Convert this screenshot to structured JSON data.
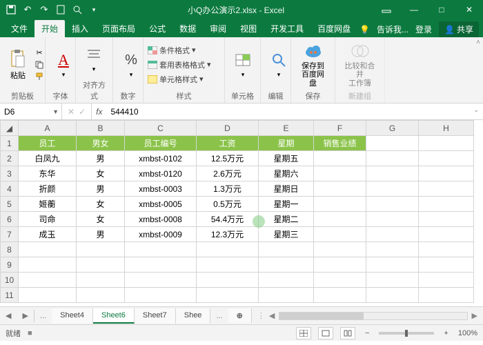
{
  "window": {
    "title": "小Q办公演示2.xlsx - Excel"
  },
  "qat": {
    "save": "保存",
    "undo": "撤销",
    "redo": "重做",
    "new": "新建",
    "preview": "打印预览"
  },
  "tabs": {
    "items": [
      {
        "label": "文件"
      },
      {
        "label": "开始"
      },
      {
        "label": "插入"
      },
      {
        "label": "页面布局"
      },
      {
        "label": "公式"
      },
      {
        "label": "数据"
      },
      {
        "label": "审阅"
      },
      {
        "label": "视图"
      },
      {
        "label": "开发工具"
      },
      {
        "label": "百度网盘"
      }
    ],
    "active_index": 1,
    "tell_me": "告诉我...",
    "login": "登录",
    "share": "共享"
  },
  "ribbon": {
    "clipboard": {
      "label": "剪贴板",
      "paste": "粘贴"
    },
    "font": {
      "label": "字体"
    },
    "align": {
      "label": "对齐方式"
    },
    "number": {
      "label": "数字"
    },
    "styles": {
      "label": "样式",
      "cond": "条件格式",
      "table": "套用表格格式",
      "cell": "单元格样式"
    },
    "cells": {
      "label": "单元格"
    },
    "editing": {
      "label": "编辑"
    },
    "baidu": {
      "label": "保存",
      "btn": "保存到\n百度网盘"
    },
    "newgroup": {
      "label": "新建组",
      "btn": "比较和合并\n工作簿"
    }
  },
  "namebox": {
    "ref": "D6",
    "fx": "fx",
    "value": "544410"
  },
  "columns": [
    "A",
    "B",
    "C",
    "D",
    "E",
    "F",
    "G",
    "H"
  ],
  "rows": [
    "1",
    "2",
    "3",
    "4",
    "5",
    "6",
    "7",
    "8",
    "9",
    "10",
    "11"
  ],
  "headers": {
    "A": "员工",
    "B": "男女",
    "C": "员工编号",
    "D": "工资",
    "E": "星期",
    "F": "销售业绩"
  },
  "data": [
    {
      "A": "白凤九",
      "B": "男",
      "C": "xmbst-0102",
      "D": "12.5万元",
      "E": "星期五"
    },
    {
      "A": "东华",
      "B": "女",
      "C": "xmbst-0120",
      "D": "2.6万元",
      "E": "星期六"
    },
    {
      "A": "折颜",
      "B": "男",
      "C": "xmbst-0003",
      "D": "1.3万元",
      "E": "星期日"
    },
    {
      "A": "姬蘅",
      "B": "女",
      "C": "xmbst-0005",
      "D": "0.5万元",
      "E": "星期一"
    },
    {
      "A": "司命",
      "B": "女",
      "C": "xmbst-0008",
      "D": "54.4万元",
      "E": "星期二"
    },
    {
      "A": "成玉",
      "B": "男",
      "C": "xmbst-0009",
      "D": "12.3万元",
      "E": "星期三"
    }
  ],
  "sheettabs": {
    "items": [
      "Sheet4",
      "Sheet6",
      "Sheet7",
      "Shee"
    ],
    "more": "...",
    "active_index": 1
  },
  "status": {
    "ready": "就绪",
    "indicator": "■",
    "zoom": "100%",
    "plus": "+",
    "minus": "−"
  }
}
